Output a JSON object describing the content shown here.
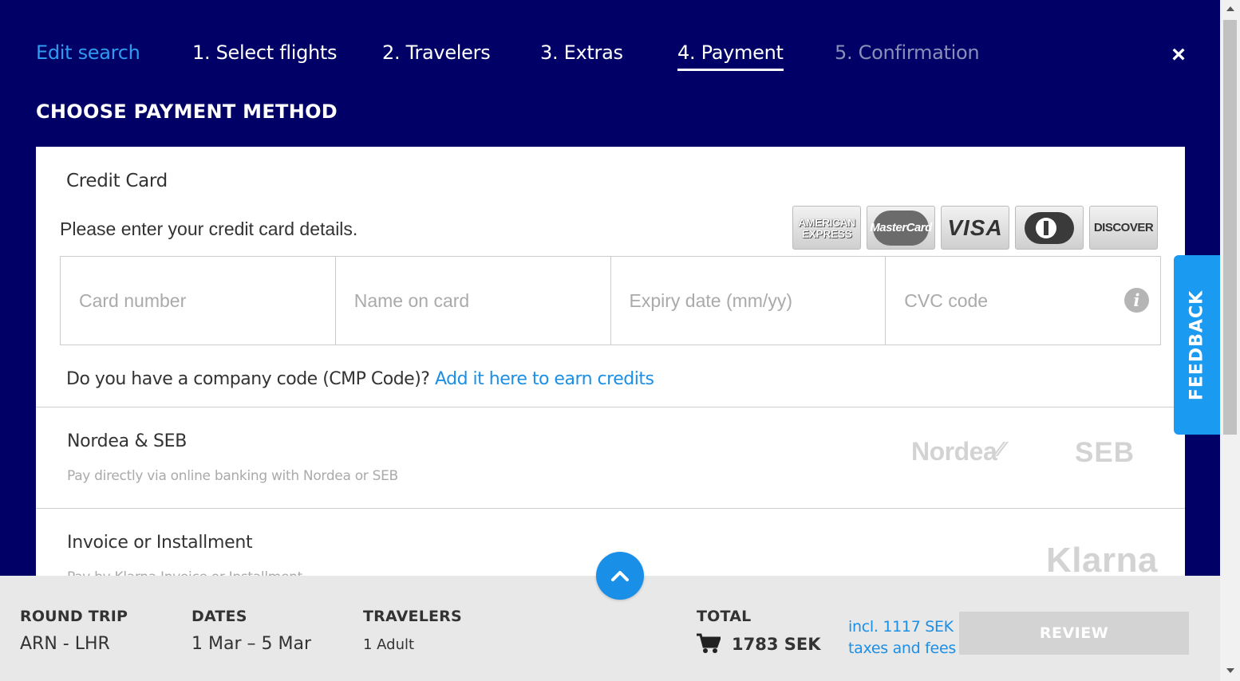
{
  "nav": {
    "edit_search": "Edit search",
    "steps": [
      "1. Select flights",
      "2. Travelers",
      "3. Extras",
      "4. Payment",
      "5. Confirmation"
    ],
    "close_symbol": "×"
  },
  "section_title": "CHOOSE PAYMENT METHOD",
  "credit_card": {
    "title": "Credit Card",
    "instruction": "Please enter your credit card details.",
    "logos": [
      "AMERICAN EXPRESS",
      "MasterCard",
      "VISA",
      "Diners Club",
      "DISCOVER"
    ],
    "fields": {
      "card_number_placeholder": "Card number",
      "name_placeholder": "Name on card",
      "expiry_placeholder": "Expiry date (mm/yy)",
      "cvc_placeholder": "CVC code"
    },
    "info_symbol": "i"
  },
  "company_code": {
    "question": "Do you have a company code (CMP Code)? ",
    "link": "Add it here to earn credits"
  },
  "methods": [
    {
      "title": "Nordea & SEB",
      "description": "Pay directly via online banking with Nordea or SEB",
      "logos": [
        "Nordea",
        "SEB"
      ]
    },
    {
      "title": "Invoice or Installment",
      "description": "Pay by Klarna Invoice or Installment",
      "logos": [
        "Klarna"
      ]
    }
  ],
  "feedback_label": "FEEDBACK",
  "summary": {
    "trip_label": "ROUND TRIP",
    "trip_value": "ARN - LHR",
    "dates_label": "DATES",
    "dates_value": "1 Mar – 5 Mar",
    "travelers_label": "TRAVELERS",
    "travelers_value": "1 Adult",
    "total_label": "TOTAL",
    "total_value": "1783 SEK",
    "taxes_line1": "incl. 1117 SEK",
    "taxes_line2": "taxes and fees",
    "review_label": "REVIEW"
  },
  "colors": {
    "background": "#000066",
    "accent": "#1a8fe8",
    "panel": "#ffffff",
    "bottom_bar": "#e8e8e8"
  }
}
